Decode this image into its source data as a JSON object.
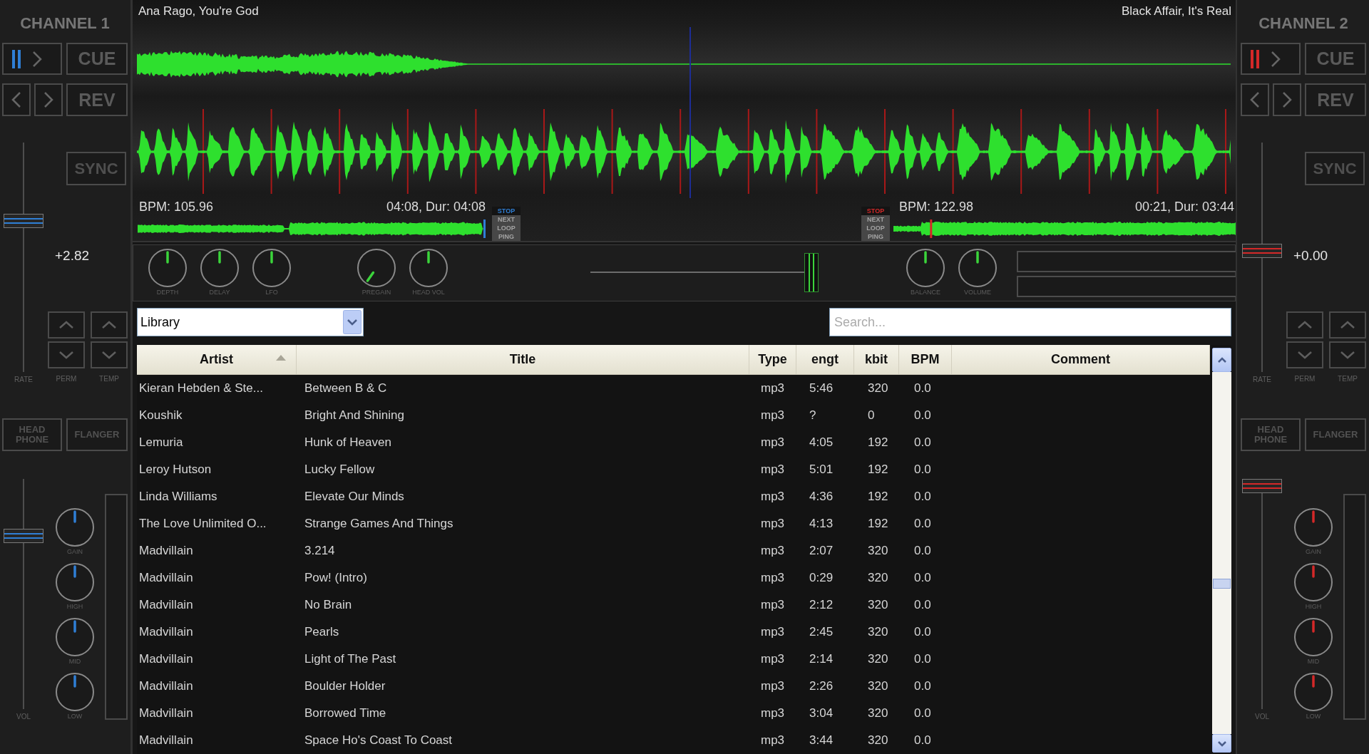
{
  "channels": [
    {
      "title": "CHANNEL 1",
      "color": "#2f7fd6",
      "playing": true,
      "cue": "CUE",
      "reverse": "REV",
      "sync": "SYNC",
      "rate": {
        "level": 0.67,
        "reading": "+2.82"
      },
      "rate_labels": [
        "RATE",
        "PERM",
        "TEMP"
      ],
      "headphone": "HEAD PHONE",
      "flanger": "FLANGER",
      "volume": {
        "level": 0.77,
        "label": "VOL"
      },
      "eq": [
        {
          "label": "GAIN",
          "kind": "center"
        },
        {
          "label": "HIGH",
          "kind": "center"
        },
        {
          "label": "MID",
          "kind": "center"
        },
        {
          "label": "LOW",
          "kind": "center"
        }
      ]
    },
    {
      "title": "CHANNEL 2",
      "color": "#d42828",
      "playing": true,
      "cue": "CUE",
      "reverse": "REV",
      "sync": "SYNC",
      "rate": {
        "level": 0.53,
        "reading": "+0.00"
      },
      "rate_labels": [
        "RATE",
        "PERM",
        "TEMP"
      ],
      "headphone": "HEAD PHONE",
      "flanger": "FLANGER",
      "volume": {
        "level": 1,
        "label": "VOL"
      },
      "eq": [
        {
          "label": "GAIN",
          "kind": "center"
        },
        {
          "label": "HIGH",
          "kind": "center"
        },
        {
          "label": "MID",
          "kind": "center"
        },
        {
          "label": "LOW",
          "kind": "center"
        }
      ]
    }
  ],
  "waveform": {
    "tracks": [
      {
        "title": "Ana Rago, You're God",
        "bpm": "BPM: 105.96",
        "time": "04:08, Dur: 04:08",
        "position": {
          "level": 1
        },
        "end_modes": [
          {
            "label": "STOP",
            "selected": true
          },
          {
            "label": "NEXT",
            "selected": false
          },
          {
            "label": "LOOP",
            "selected": false
          },
          {
            "label": "PING",
            "selected": false
          }
        ]
      },
      {
        "title": "Black Affair, It's Real",
        "bpm": "BPM: 122.98",
        "time": "00:21, Dur: 03:44",
        "position": {
          "level": 0.11
        },
        "end_modes": [
          {
            "label": "STOP",
            "selected": true
          },
          {
            "label": "NEXT",
            "selected": false
          },
          {
            "label": "LOOP",
            "selected": false
          },
          {
            "label": "PING",
            "selected": false
          }
        ]
      }
    ]
  },
  "effects_bar": {
    "knobs": [
      {
        "label": "DEPTH",
        "kind": "center"
      },
      {
        "label": "DELAY",
        "kind": "center"
      },
      {
        "label": "LFO",
        "kind": "center"
      },
      {
        "label": "PREGAIN",
        "kind": "minimum"
      },
      {
        "label": "HEAD VOL",
        "kind": "center"
      }
    ],
    "crossfader": {
      "level": 1
    },
    "output_knobs": [
      {
        "label": "BALANCE",
        "kind": "center"
      },
      {
        "label": "VOLUME",
        "kind": "center"
      }
    ]
  },
  "library": {
    "dropdown": {
      "value": "Library"
    },
    "search": {
      "placeholder": "Search..."
    }
  },
  "table": {
    "columns": [
      {
        "label": "Artist",
        "sorted": true
      },
      {
        "label": "Title",
        "sorted": false
      },
      {
        "label": "Type",
        "sorted": false
      },
      {
        "label": "engt",
        "sorted": false
      },
      {
        "label": "kbit",
        "sorted": false
      },
      {
        "label": "BPM",
        "sorted": false
      },
      {
        "label": "Comment",
        "sorted": false
      }
    ],
    "rows": [
      [
        "Kieran Hebden & Ste...",
        "Between B & C",
        "mp3",
        "5:46",
        "320",
        "0.0"
      ],
      [
        "Koushik",
        "Bright And Shining",
        "mp3",
        "?",
        "0",
        "0.0"
      ],
      [
        "Lemuria",
        "Hunk of Heaven",
        "mp3",
        "4:05",
        "192",
        "0.0"
      ],
      [
        "Leroy Hutson",
        "Lucky Fellow",
        "mp3",
        "5:01",
        "192",
        "0.0"
      ],
      [
        "Linda Williams",
        "Elevate Our Minds",
        "mp3",
        "4:36",
        "192",
        "0.0"
      ],
      [
        "The Love Unlimited O...",
        "Strange Games And Things",
        "mp3",
        "4:13",
        "192",
        "0.0"
      ],
      [
        "Madvillain",
        "3.214",
        "mp3",
        "2:07",
        "320",
        "0.0"
      ],
      [
        "Madvillain",
        "Pow! (Intro)",
        "mp3",
        "0:29",
        "320",
        "0.0"
      ],
      [
        "Madvillain",
        "No Brain",
        "mp3",
        "2:12",
        "320",
        "0.0"
      ],
      [
        "Madvillain",
        "Pearls",
        "mp3",
        "2:45",
        "320",
        "0.0"
      ],
      [
        "Madvillain",
        "Light of The Past",
        "mp3",
        "2:14",
        "320",
        "0.0"
      ],
      [
        "Madvillain",
        "Boulder Holder",
        "mp3",
        "2:26",
        "320",
        "0.0"
      ],
      [
        "Madvillain",
        "Borrowed Time",
        "mp3",
        "3:04",
        "320",
        "0.0"
      ],
      [
        "Madvillain",
        "Space Ho's Coast To Coast",
        "mp3",
        "3:44",
        "320",
        "0.0"
      ]
    ]
  }
}
